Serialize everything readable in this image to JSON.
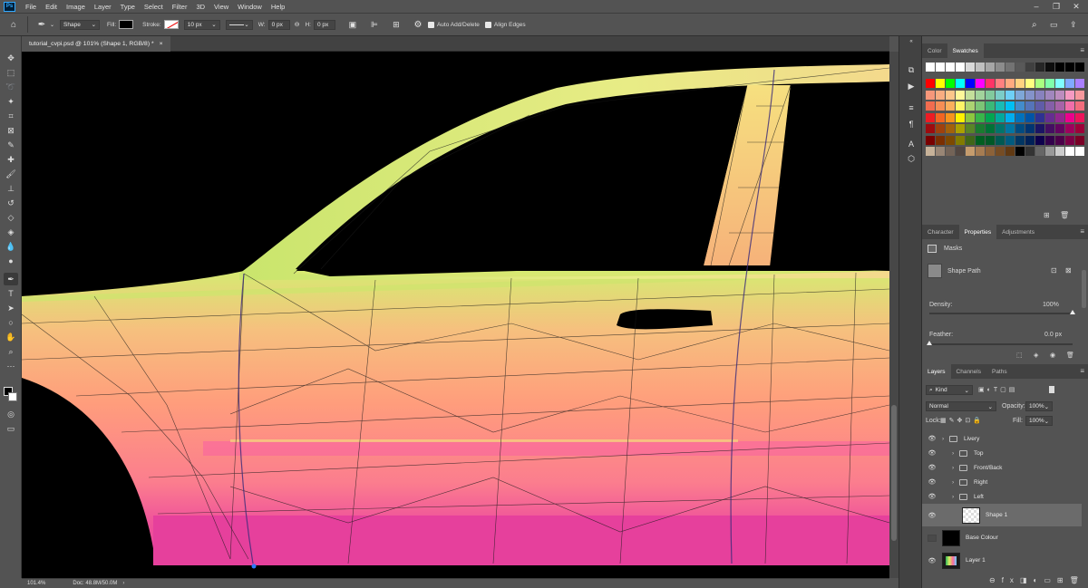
{
  "app": {
    "logo": "Ps"
  },
  "menu": [
    "File",
    "Edit",
    "Image",
    "Layer",
    "Type",
    "Select",
    "Filter",
    "3D",
    "View",
    "Window",
    "Help"
  ],
  "options": {
    "mode": "Shape",
    "fill_label": "Fill:",
    "stroke_label": "Stroke:",
    "stroke_width": "10 px",
    "w_label": "W:",
    "w_value": "0 px",
    "h_label": "H:",
    "h_value": "0 px",
    "auto_add_delete": "Auto Add/Delete",
    "align_edges": "Align Edges"
  },
  "document": {
    "tab_title": "tutorial_cvpi.psd @ 101% (Shape 1, RGB/8) *",
    "close": "×"
  },
  "status": {
    "zoom": "101.4%",
    "doc_size": "Doc: 48.8M/50.0M"
  },
  "swatches_panel": {
    "tabs": [
      "Color",
      "Swatches"
    ],
    "active": "Swatches",
    "row1": [
      "#ffffff",
      "#ffffff",
      "#ffffff",
      "#ffffff",
      "#d9d9d9",
      "#bfbfbf",
      "#a6a6a6",
      "#8c8c8c",
      "#737373",
      "#595959",
      "#404040",
      "#262626",
      "#0d0d0d",
      "#000000",
      "#000000",
      "#000000"
    ],
    "grid": [
      [
        "#ff0000",
        "#ffff00",
        "#00ff00",
        "#00ffff",
        "#0000ff",
        "#ff00ff",
        "#ff3366",
        "#ff8080",
        "#ffaa80",
        "#ffd280",
        "#ffff80",
        "#aaff80",
        "#80ffaa",
        "#80ffff",
        "#80aaff",
        "#aa80ff"
      ],
      [
        "#f7977a",
        "#f9ad81",
        "#fdc68a",
        "#fff79a",
        "#c4df9b",
        "#a2d39c",
        "#82ca9d",
        "#7bcdc8",
        "#6ecff6",
        "#7ea7d8",
        "#8493ca",
        "#8882be",
        "#a187be",
        "#bc8dbf",
        "#f49ac2",
        "#f6989d"
      ],
      [
        "#f26c4f",
        "#f68e55",
        "#fbaf5c",
        "#fff467",
        "#acd372",
        "#7cc576",
        "#3bb878",
        "#1abbb4",
        "#00bff3",
        "#438ccb",
        "#5574b9",
        "#605ca8",
        "#855fa8",
        "#a763a8",
        "#f06ea9",
        "#f26d7d"
      ],
      [
        "#ed1c24",
        "#f26522",
        "#f7941d",
        "#fff200",
        "#8dc63f",
        "#39b54a",
        "#00a651",
        "#00a99d",
        "#00aeef",
        "#0072bc",
        "#0054a6",
        "#2e3192",
        "#662d91",
        "#92278f",
        "#ec008c",
        "#ed145b"
      ],
      [
        "#9e0b0f",
        "#a0410d",
        "#a3620a",
        "#aba000",
        "#598527",
        "#1a7b30",
        "#007236",
        "#00746b",
        "#0076a3",
        "#004b80",
        "#003471",
        "#1b1464",
        "#440e62",
        "#630460",
        "#9e005d",
        "#9e0039"
      ],
      [
        "#790000",
        "#7b2e00",
        "#7d4900",
        "#827b00",
        "#406618",
        "#005e20",
        "#005826",
        "#005952",
        "#005b7f",
        "#003663",
        "#002157",
        "#0d004c",
        "#32004b",
        "#4b0049",
        "#7b0046",
        "#7a0026"
      ],
      [
        "#c7b299",
        "#998675",
        "#736357",
        "#534741",
        "#c69c6d",
        "#a67c52",
        "#8c6239",
        "#754c24",
        "#603913",
        "#000000",
        "#333333",
        "#666666",
        "#999999",
        "#cccccc",
        "#ffffff",
        "#ffffff"
      ]
    ]
  },
  "properties_panel": {
    "tabs": [
      "Character",
      "Properties",
      "Adjustments"
    ],
    "active": "Properties",
    "masks": "Masks",
    "shape_path": "Shape Path",
    "density_label": "Density:",
    "density_value": "100%",
    "density_level": 1.0,
    "feather_label": "Feather:",
    "feather_value": "0.0 px",
    "feather_level": 0.0
  },
  "layers_panel": {
    "tabs": [
      "Layers",
      "Channels",
      "Paths"
    ],
    "active": "Layers",
    "filter_kind": "Kind",
    "blend_mode": "Normal",
    "opacity_label": "Opacity:",
    "opacity_value": "100%",
    "lock_label": "Lock:",
    "fill_label": "Fill:",
    "fill_value": "100%",
    "layers": [
      {
        "name": "Livery",
        "type": "group",
        "indent": 0,
        "visible": true,
        "selected": false
      },
      {
        "name": "Top",
        "type": "group",
        "indent": 1,
        "visible": true,
        "selected": false
      },
      {
        "name": "Front/Back",
        "type": "group",
        "indent": 1,
        "visible": true,
        "selected": false
      },
      {
        "name": "Right",
        "type": "group",
        "indent": 1,
        "visible": true,
        "selected": false
      },
      {
        "name": "Left",
        "type": "group",
        "indent": 1,
        "visible": true,
        "selected": false
      },
      {
        "name": "Shape 1",
        "type": "shape",
        "indent": 2,
        "visible": true,
        "selected": true
      },
      {
        "name": "Base Colour",
        "type": "fill",
        "indent": 0,
        "visible": false,
        "selected": false
      },
      {
        "name": "Layer 1",
        "type": "pixel",
        "indent": 0,
        "visible": true,
        "selected": false
      }
    ]
  }
}
